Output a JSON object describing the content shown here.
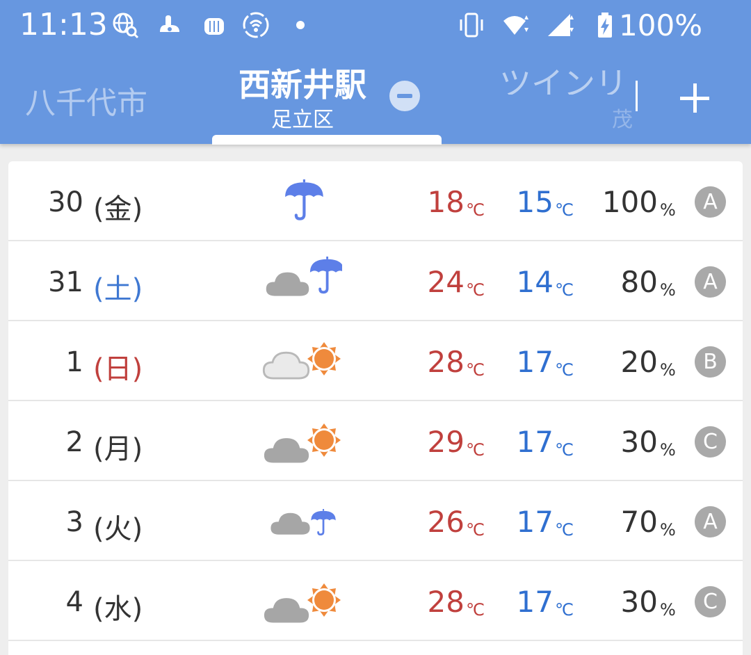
{
  "status_bar": {
    "time": "11:13",
    "battery": "100%",
    "icons": [
      "globe-search-icon",
      "app-notification-icon",
      "app-notification-icon",
      "hotspot-icon",
      "dot-icon",
      "vibrate-icon",
      "wifi-icon",
      "signal-icon",
      "battery-icon"
    ]
  },
  "tabs": {
    "left": "八千代市",
    "center_title": "西新井駅",
    "center_subtitle": "足立区",
    "right": "ツインリ",
    "right_subtitle": "茂"
  },
  "colors": {
    "header": "#6797e0",
    "high": "#c0403d",
    "low": "#2f6fd0",
    "sun": "#ef8a3c",
    "umbrella": "#5d7fe8",
    "cloud": "#a6a6a6"
  },
  "forecast": [
    {
      "day": "30",
      "dow": "(金)",
      "dow_type": "weekday",
      "icon": "rain",
      "high": "18",
      "high_unit": "℃",
      "low": "15",
      "low_unit": "℃",
      "rain": "100",
      "rain_unit": "%",
      "grade": "A"
    },
    {
      "day": "31",
      "dow": "(土)",
      "dow_type": "sat",
      "icon": "cloudy-rain",
      "high": "24",
      "high_unit": "℃",
      "low": "14",
      "low_unit": "℃",
      "rain": "80",
      "rain_unit": "%",
      "grade": "A"
    },
    {
      "day": "1",
      "dow": "(日)",
      "dow_type": "sun",
      "icon": "sunny-cloud-light",
      "high": "28",
      "high_unit": "℃",
      "low": "17",
      "low_unit": "℃",
      "rain": "20",
      "rain_unit": "%",
      "grade": "B"
    },
    {
      "day": "2",
      "dow": "(月)",
      "dow_type": "weekday",
      "icon": "cloudy-sun",
      "high": "29",
      "high_unit": "℃",
      "low": "17",
      "low_unit": "℃",
      "rain": "30",
      "rain_unit": "%",
      "grade": "C"
    },
    {
      "day": "3",
      "dow": "(火)",
      "dow_type": "weekday",
      "icon": "cloudy-rain-small",
      "high": "26",
      "high_unit": "℃",
      "low": "17",
      "low_unit": "℃",
      "rain": "70",
      "rain_unit": "%",
      "grade": "A"
    },
    {
      "day": "4",
      "dow": "(水)",
      "dow_type": "weekday",
      "icon": "cloudy-sun",
      "high": "28",
      "high_unit": "℃",
      "low": "17",
      "low_unit": "℃",
      "rain": "30",
      "rain_unit": "%",
      "grade": "C"
    }
  ]
}
